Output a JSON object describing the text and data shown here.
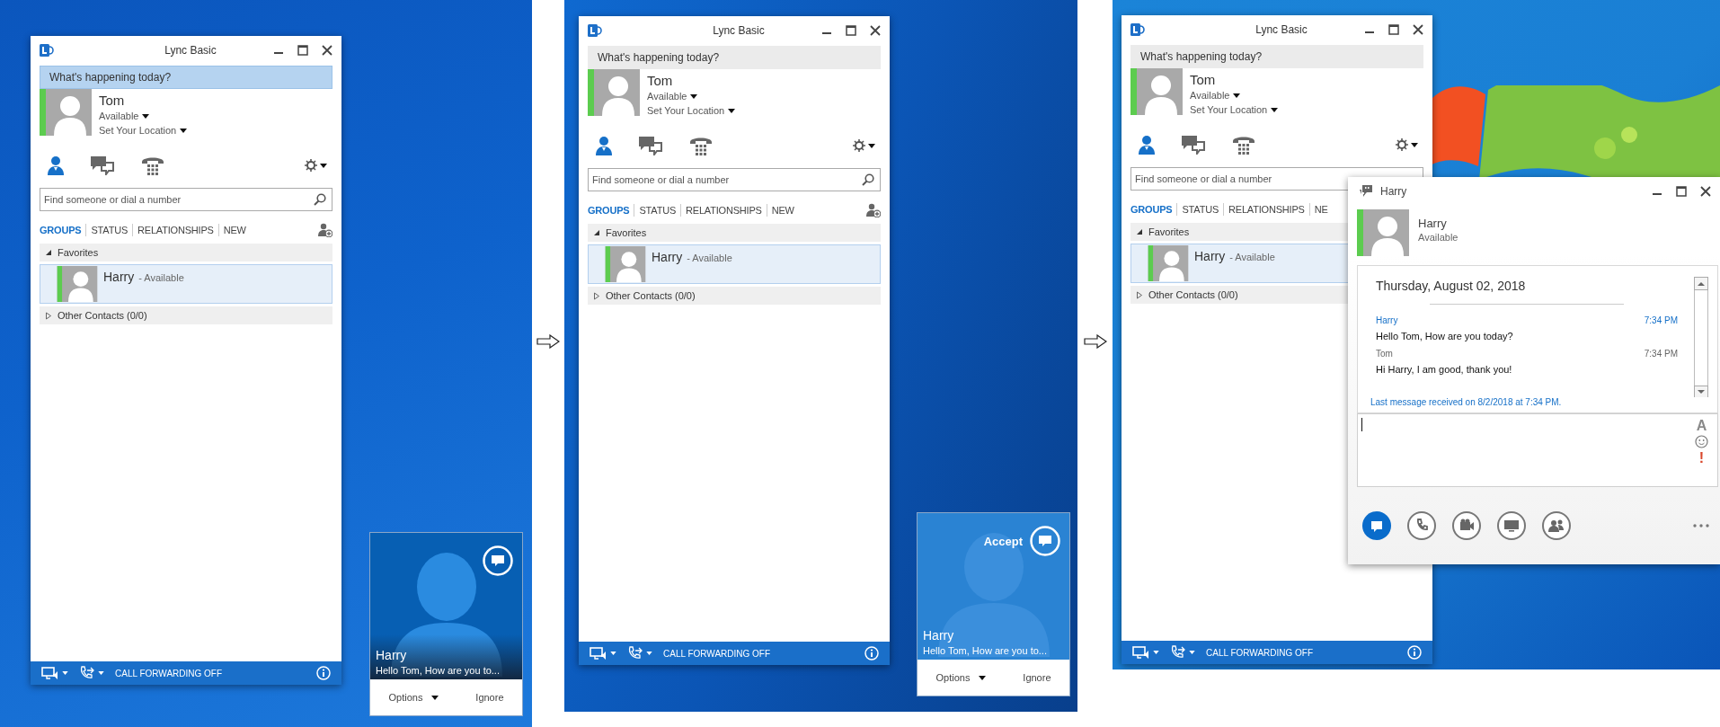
{
  "panels": [
    {
      "lync": {
        "title": "Lync Basic",
        "overlapped": false,
        "note": {
          "text": "What's happening today?",
          "highlighted": true
        },
        "user": {
          "name": "Tom",
          "presence": "Available",
          "location": "Set Your Location"
        },
        "search": {
          "placeholder": "Find someone or dial a number"
        },
        "tabs": [
          {
            "label": "GROUPS",
            "selected": true
          },
          {
            "label": "STATUS",
            "selected": false
          },
          {
            "label": "RELATIONSHIPS",
            "selected": false
          },
          {
            "label": "NEW",
            "selected": false
          }
        ],
        "groups": [
          {
            "label": "Favorites",
            "expanded": true,
            "contacts": [
              {
                "name": "Harry",
                "presence": "- Available",
                "selected": true
              }
            ]
          },
          {
            "label": "Other Contacts (0/0)",
            "expanded": false
          }
        ],
        "status_bar": {
          "text": "CALL FORWARDING OFF"
        }
      },
      "toast": {
        "hovered": false,
        "name": "Harry",
        "message": "Hello Tom, How are you to...",
        "buttons": [
          {
            "label": "Options",
            "kind": "dropdown"
          },
          {
            "label": "Ignore",
            "kind": "plain"
          }
        ]
      }
    },
    {
      "lync": {
        "title": "Lync Basic",
        "overlapped": false,
        "note": {
          "text": "What's happening today?",
          "highlighted": false
        },
        "user": {
          "name": "Tom",
          "presence": "Available",
          "location": "Set Your Location"
        },
        "search": {
          "placeholder": "Find someone or dial a number"
        },
        "tabs": [
          {
            "label": "GROUPS",
            "selected": true
          },
          {
            "label": "STATUS",
            "selected": false
          },
          {
            "label": "RELATIONSHIPS",
            "selected": false
          },
          {
            "label": "NEW",
            "selected": false
          }
        ],
        "groups": [
          {
            "label": "Favorites",
            "expanded": true,
            "contacts": [
              {
                "name": "Harry",
                "presence": "- Available",
                "selected": true
              }
            ]
          },
          {
            "label": "Other Contacts (0/0)",
            "expanded": false
          }
        ],
        "status_bar": {
          "text": "CALL FORWARDING OFF"
        }
      },
      "toast": {
        "hovered": true,
        "accept_label": "Accept",
        "name": "Harry",
        "message": "Hello Tom, How are you to...",
        "buttons": [
          {
            "label": "Options",
            "kind": "dropdown"
          },
          {
            "label": "Ignore",
            "kind": "plain"
          }
        ]
      }
    },
    {
      "lync": {
        "title": "Lync Basic",
        "overlapped": true,
        "note": {
          "text": "What's happening today?",
          "highlighted": false
        },
        "user": {
          "name": "Tom",
          "presence": "Available",
          "location": "Set Your Location"
        },
        "search": {
          "placeholder": "Find someone or dial a number"
        },
        "tabs": [
          {
            "label": "GROUPS",
            "selected": true
          },
          {
            "label": "STATUS",
            "selected": false
          },
          {
            "label": "RELATIONSHIPS",
            "selected": false
          },
          {
            "label": "NE",
            "selected": false
          }
        ],
        "groups": [
          {
            "label": "Favorites",
            "expanded": true,
            "contacts": [
              {
                "name": "Harry",
                "presence": "- Available",
                "selected": true
              }
            ]
          },
          {
            "label": "Other Contacts (0/0)",
            "expanded": false
          }
        ],
        "status_bar": {
          "text": "CALL FORWARDING OFF"
        }
      },
      "chat": {
        "title": "Harry",
        "contact": {
          "name": "Harry",
          "presence": "Available"
        },
        "date": "Thursday, August 02, 2018",
        "messages": [
          {
            "sender": "Harry",
            "time": "7:34 PM",
            "text": "Hello Tom, How are you today?",
            "incoming": true
          },
          {
            "sender": "Tom",
            "time": "7:34 PM",
            "text": "Hi Harry, I am good, thank you!",
            "incoming": false
          }
        ],
        "last_message": "Last message received on 8/2/2018 at 7:34 PM.",
        "tools": [
          {
            "kind": "glyph",
            "text": "A",
            "color": "#8a8a8a"
          },
          {
            "kind": "emoticon"
          },
          {
            "kind": "glyph",
            "text": "!",
            "color": "#d9472b"
          }
        ],
        "modes": [
          {
            "kind": "im",
            "selected": true
          },
          {
            "kind": "call",
            "selected": false
          },
          {
            "kind": "video",
            "selected": false
          },
          {
            "kind": "screen",
            "selected": false
          },
          {
            "kind": "people",
            "selected": false
          }
        ]
      }
    }
  ]
}
